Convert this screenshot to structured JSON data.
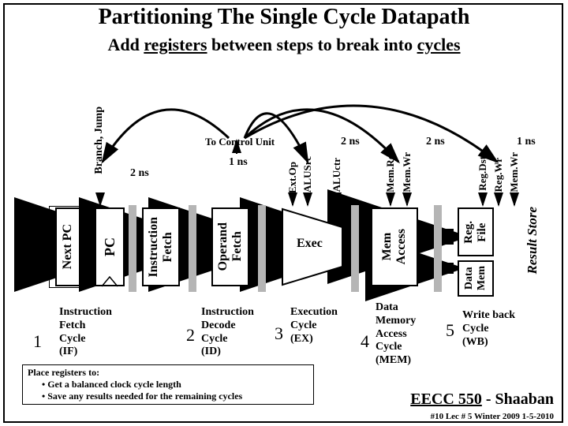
{
  "title": "Partitioning The Single Cycle Datapath",
  "subtitle_parts": {
    "a": "Add ",
    "b": "registers",
    "c": " between steps to break into ",
    "d": "cycles"
  },
  "signals": {
    "branch_jump": "Branch, Jump",
    "ext_op": "Ext.Op",
    "alusrc": "ALUSrc",
    "aluctr": "ALUctr",
    "memrd": "Mem.Rd",
    "memwr": "Mem.Wr",
    "regdst": "Reg.Dst",
    "regwr": "Reg.Wr",
    "memwr2": "Mem.Wr"
  },
  "to_control": "To Control Unit",
  "timings": {
    "t_if": "2 ns",
    "t_id": "1 ns",
    "t_ex": "2 ns",
    "t_mem": "2 ns",
    "t_wb": "1 ns"
  },
  "blocks": {
    "next_pc": "Next PC",
    "pc": "PC",
    "ifetch": "Instruction\nFetch",
    "opfetch": "Operand\nFetch",
    "exec": "Exec",
    "memacc": "Mem\nAccess",
    "regfile": "Reg.\nFile",
    "datamem": "Data\nMem",
    "result_store": "Result Store"
  },
  "stages": {
    "s1": {
      "num": "1",
      "lines": [
        "Instruction",
        "Fetch",
        "Cycle",
        "(IF)"
      ]
    },
    "s2": {
      "num": "2",
      "lines": [
        "Instruction",
        "Decode",
        "Cycle",
        "(ID)"
      ]
    },
    "s3": {
      "num": "3",
      "lines": [
        "Execution",
        "Cycle",
        "(EX)"
      ]
    },
    "s4": {
      "num": "4",
      "lines": [
        "Data",
        "Memory",
        "Access",
        "Cycle",
        "(MEM)"
      ]
    },
    "s5": {
      "num": "5",
      "lines": [
        "Write back",
        "Cycle",
        "(WB)"
      ]
    }
  },
  "note": {
    "title": "Place registers to:",
    "b1": "• Get a balanced clock cycle length",
    "b2": "• Save any results needed for the remaining cycles"
  },
  "footer": {
    "course": "EECC 550",
    "teacher": "Shaaban",
    "lec": "#10  Lec # 5  Winter 2009 1-5-2010"
  }
}
